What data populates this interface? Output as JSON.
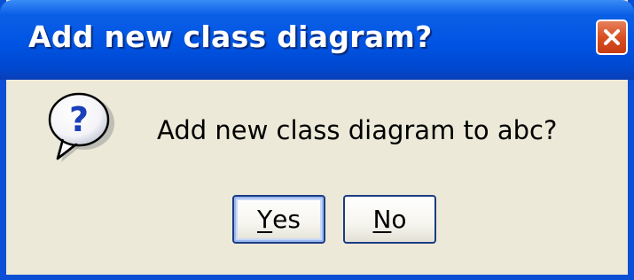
{
  "dialog": {
    "title": "Add new class diagram?",
    "message": "Add new class diagram to abc?",
    "buttons": {
      "yes_mnemonic": "Y",
      "yes_rest": "es",
      "no_mnemonic": "N",
      "no_rest": "o"
    },
    "icons": {
      "question": "question-icon",
      "close": "close-icon"
    },
    "colors": {
      "titlebar": "#0054e3",
      "body": "#ece9d8",
      "close_button": "#d84f22",
      "question_mark": "#1a3fb8"
    }
  }
}
